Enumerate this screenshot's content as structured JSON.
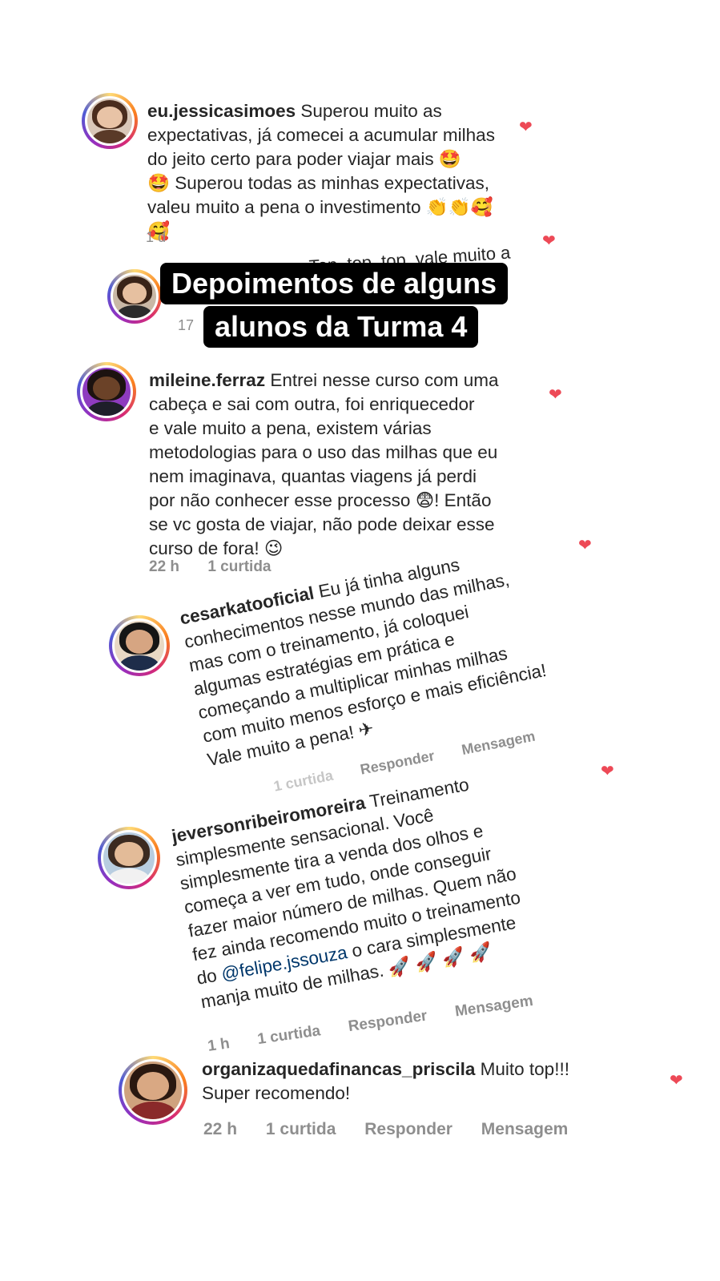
{
  "overlay": {
    "line1": "Depoimentos de alguns",
    "line2": "alunos da Turma 4"
  },
  "partial": {
    "text": "Top, top, top, vale muito a",
    "time_1d": "1 d",
    "time_17": "17"
  },
  "comments": [
    {
      "username": "eu.jessicasimoes",
      "lines": [
        "Superou muito as",
        "expectativas, já comecei a acumular milhas",
        "do jeito certo para poder viajar mais 🤩",
        "🤩 Superou todas as minhas expectativas,",
        "valeu muito a pena o investimento 👏👏🥰",
        "🥰"
      ]
    },
    {
      "username": "mileine.ferraz",
      "lines": [
        "Entrei nesse curso com uma",
        "cabeça e sai com outra, foi enriquecedor",
        "e vale muito a pena, existem várias",
        "metodologias para o uso das milhas que eu",
        "nem imaginava, quantas viagens já perdi",
        "por não conhecer esse processo 😨! Então",
        "se vc gosta de viajar, não pode deixar esse",
        "curso de fora! 😉"
      ],
      "time": "22 h",
      "likes": "1 curtida"
    },
    {
      "username": "cesarkatooficial",
      "lines": [
        "Eu já tinha alguns",
        "conhecimentos nesse mundo das milhas,",
        "mas com o treinamento, já coloquei",
        "algumas estratégias em prática e",
        "começando a multiplicar minhas milhas",
        "com muito menos esforço e mais eficiência!",
        "Vale muito a pena! ✈"
      ],
      "likes": "1 curtida",
      "reply": "Responder",
      "message": "Mensagem"
    },
    {
      "username": "jeversonribeiromoreira",
      "lines_prefix": [
        "Treinamento",
        "simplesmente sensacional. Você",
        "simplesmente tira a venda dos olhos e",
        "começa a ver em tudo, onde conseguir",
        "fazer maior número de milhas. Quem não",
        "fez ainda recomendo muito o treinamento"
      ],
      "mention_pre": "do ",
      "mention": "@felipe.jssouza",
      "mention_post": " o cara simplesmente",
      "last_line": "manja muito de milhas. 🚀 🚀 🚀 🚀",
      "time": "1 h",
      "likes": "1 curtida",
      "reply": "Responder",
      "message": "Mensagem"
    },
    {
      "username": "organizaquedafinancas_priscila",
      "lines": [
        "Muito top!!!",
        "Super recomendo!"
      ],
      "time": "22 h",
      "likes": "1 curtida",
      "reply": "Responder",
      "message": "Mensagem"
    }
  ],
  "colors": {
    "heart": "#ed4956",
    "text": "#262626",
    "meta": "#8e8e8e",
    "mention": "#00376b",
    "overlay_bg": "#000000"
  }
}
